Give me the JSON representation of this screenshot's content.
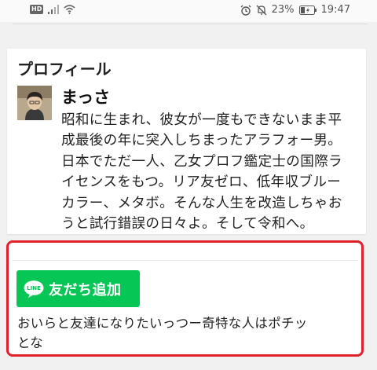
{
  "status_bar": {
    "hd_label": "HD",
    "battery_percent": "23%",
    "time": "19:47",
    "icons": [
      "signal-icon",
      "wifi-icon",
      "alarm-icon",
      "mute-icon",
      "battery-icon"
    ]
  },
  "profile": {
    "title": "プロフィール",
    "name": "まっさ",
    "bio_lines": [
      "昭和に生まれ、彼女が一度もできないまま平",
      "成最後の年に突入しちまったアラフォー男。",
      "日本でただ一人、乙女プロフ鑑定士の国際ラ",
      "イセンスをもつ。リア友ゼロ、低年収ブルー",
      "カラー、メタボ。そんな人生を改造しちゃお",
      "うと試行錯誤の日々よ。そして令和へ。"
    ]
  },
  "line_cta": {
    "logo_text": "LINE",
    "button_label": "友だち追加",
    "message_lines": [
      "おいらと友達になりたいっつー奇特な人はポチッ",
      "とな"
    ],
    "colors": {
      "line_green": "#06c755",
      "highlight_border": "#e0222c"
    }
  }
}
